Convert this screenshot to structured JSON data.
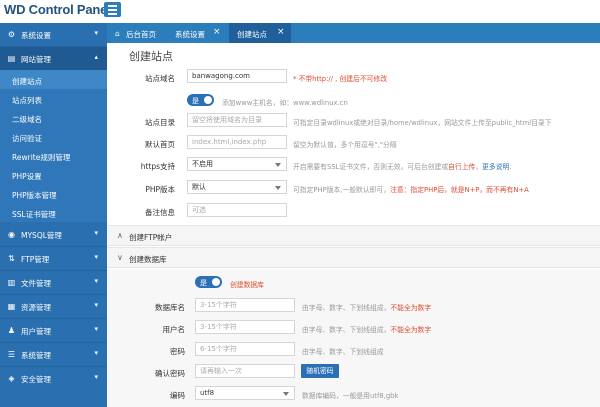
{
  "app": {
    "logo": "WD Control Panel"
  },
  "sidebar": {
    "items": [
      {
        "label": "系统设置",
        "icon": "gear-icon",
        "glyph": "⚙",
        "chevron": "▾"
      },
      {
        "label": "网站管理",
        "icon": "site-icon",
        "glyph": "▤",
        "chevron": "▴"
      },
      {
        "label": "MYSQL管理",
        "icon": "database-icon",
        "glyph": "◉",
        "chevron": "▾"
      },
      {
        "label": "FTP管理",
        "icon": "ftp-icon",
        "glyph": "⇅",
        "chevron": "▾"
      },
      {
        "label": "文件管理",
        "icon": "file-icon",
        "glyph": "▥",
        "chevron": "▾"
      },
      {
        "label": "资源管理",
        "icon": "resource-icon",
        "glyph": "▦",
        "chevron": "▾"
      },
      {
        "label": "用户管理",
        "icon": "user-icon",
        "glyph": "♟",
        "chevron": "▾"
      },
      {
        "label": "系统管理",
        "icon": "system-icon",
        "glyph": "☰",
        "chevron": "▾"
      },
      {
        "label": "安全管理",
        "icon": "shield-icon",
        "glyph": "◈",
        "chevron": "▾"
      }
    ],
    "subitems": [
      {
        "label": "创建站点"
      },
      {
        "label": "站点列表"
      },
      {
        "label": "二级域名"
      },
      {
        "label": "访问验证"
      },
      {
        "label": "Rewrite规则管理"
      },
      {
        "label": "PHP设置"
      },
      {
        "label": "PHP版本管理"
      },
      {
        "label": "SSL证书管理"
      }
    ]
  },
  "tabs": [
    {
      "label": "后台首页",
      "icon": "home-icon",
      "glyph": "⌂"
    },
    {
      "label": "系统设置",
      "close": "×"
    },
    {
      "label": "创建站点",
      "close": "×"
    }
  ],
  "form": {
    "title": "创建站点",
    "domain": {
      "label": "站点域名",
      "value": "banwagong.com",
      "hint": "* 不带http:// , 创建后不可修改"
    },
    "www": {
      "toggle": "是",
      "hint": "添加www主机名，如：www.wdlinux.cn"
    },
    "dir": {
      "label": "站点目录",
      "placeholder": "留空将使用域名为目录",
      "hint": "可指定目录wdlinux或绝对目录/home/wdlinux，网站文件上传至public_html目录下"
    },
    "index": {
      "label": "默认首页",
      "placeholder": "index.html,index.php",
      "hint": "留空为默认值，多个用逗号\",\"分隔"
    },
    "https": {
      "label": "https支持",
      "value": "不启用",
      "hint": "开启需要有SSL证书文件，否则无效。可后台创建或",
      "hint_red": "自行上传",
      "hint_sep": "，",
      "hint_blue": "更多说明",
      "hint_end": "."
    },
    "php": {
      "label": "PHP版本",
      "value": "默认",
      "hint": "可指定PHP版本,一般默认即可，",
      "hint_red": "注意：指定PHP后，就是N+P，而不再有N+A"
    },
    "note": {
      "label": "备注信息",
      "placeholder": "可选"
    }
  },
  "sections": {
    "ftp": {
      "label": "创建FTP帐户",
      "arrow": "∧"
    },
    "db": {
      "label": "创建数据库",
      "arrow": "∨"
    }
  },
  "db": {
    "toggle": "是",
    "toggle_hint": "创建数据库",
    "name": {
      "label": "数据库名",
      "placeholder": "3-15个字符",
      "hint": "由字母、数字、下划线组成，",
      "hint_red": "不能全为数字"
    },
    "user": {
      "label": "用户名",
      "placeholder": "3-15个字符",
      "hint": "由字母、数字、下划线组成，",
      "hint_red": "不能全为数字"
    },
    "pass": {
      "label": "密码",
      "placeholder": "6-15个字符",
      "hint": "由字母、数字、下划线组成"
    },
    "confirm": {
      "label": "确认密码",
      "placeholder": "请再输入一次",
      "button": "随机密码"
    },
    "charset": {
      "label": "编码",
      "value": "utf8",
      "hint": "数据库编码，一般是用utf8,gbk"
    }
  }
}
